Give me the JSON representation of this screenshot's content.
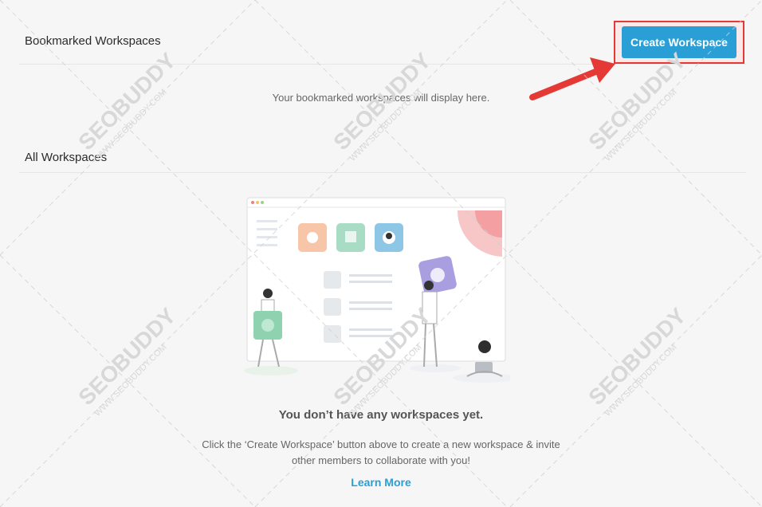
{
  "bookmarked": {
    "title": "Bookmarked Workspaces",
    "empty_text": "Your bookmarked workspaces will display here."
  },
  "create_button": {
    "label": "Create Workspace",
    "color": "#2a9fd6"
  },
  "all": {
    "title": "All Workspaces",
    "empty_title": "You don’t have any workspaces yet.",
    "empty_desc_line1": "Click the ‘Create Workspace’ button above to create a new workspace & invite",
    "empty_desc_line2": "other members to collaborate with you!",
    "learn_more": "Learn More"
  },
  "watermark": {
    "text": "SEOBUDDY",
    "subtext": "WWW.SEOBUDDY.COM"
  },
  "colors": {
    "accent": "#2a9fd6",
    "highlight": "#e53935"
  }
}
